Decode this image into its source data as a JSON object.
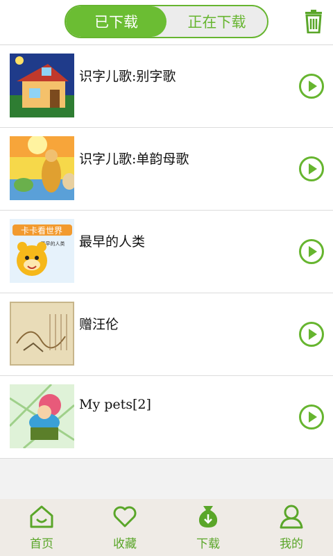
{
  "header": {
    "tabs": [
      {
        "label": "已下载",
        "active": true
      },
      {
        "label": "正在下载",
        "active": false
      }
    ],
    "trash_icon": "trash-icon"
  },
  "downloads": [
    {
      "title": "识字儿歌:别字歌"
    },
    {
      "title": "识字儿歌:单韵母歌"
    },
    {
      "title": "最早的人类",
      "thumb_text": "卡卡看世界",
      "thumb_subtext": "最早的人类"
    },
    {
      "title": "赠汪伦"
    },
    {
      "title": "My pets[2]"
    }
  ],
  "bottom_nav": [
    {
      "label": "首页",
      "icon": "home-icon"
    },
    {
      "label": "收藏",
      "icon": "heart-icon"
    },
    {
      "label": "下载",
      "icon": "download-bag-icon"
    },
    {
      "label": "我的",
      "icon": "person-icon"
    }
  ],
  "colors": {
    "accent": "#6bbd33",
    "icon_green": "#5aa629",
    "bottom_bg": "#efebe6"
  }
}
